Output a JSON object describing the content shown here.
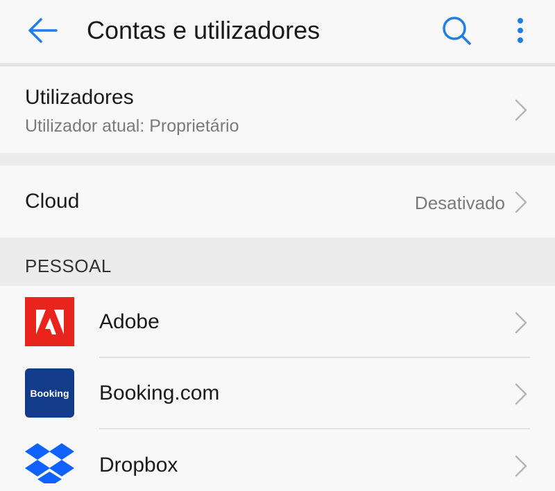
{
  "header": {
    "title": "Contas e utilizadores",
    "back_icon": "arrow-left-icon",
    "search_icon": "search-icon",
    "more_icon": "more-vertical-icon",
    "accent": "#1e7ee6"
  },
  "users": {
    "title": "Utilizadores",
    "subtitle": "Utilizador atual: Proprietário"
  },
  "cloud": {
    "title": "Cloud",
    "value": "Desativado"
  },
  "section": {
    "title": "PESSOAL"
  },
  "accounts": [
    {
      "label": "Adobe",
      "icon": "adobe-logo-icon",
      "icon_color": "#e8241c"
    },
    {
      "label": "Booking.com",
      "icon": "booking-logo-icon",
      "icon_text": "Booking",
      "icon_color": "#123b8a"
    },
    {
      "label": "Dropbox",
      "icon": "dropbox-logo-icon",
      "icon_color": "#0f62fe"
    }
  ]
}
